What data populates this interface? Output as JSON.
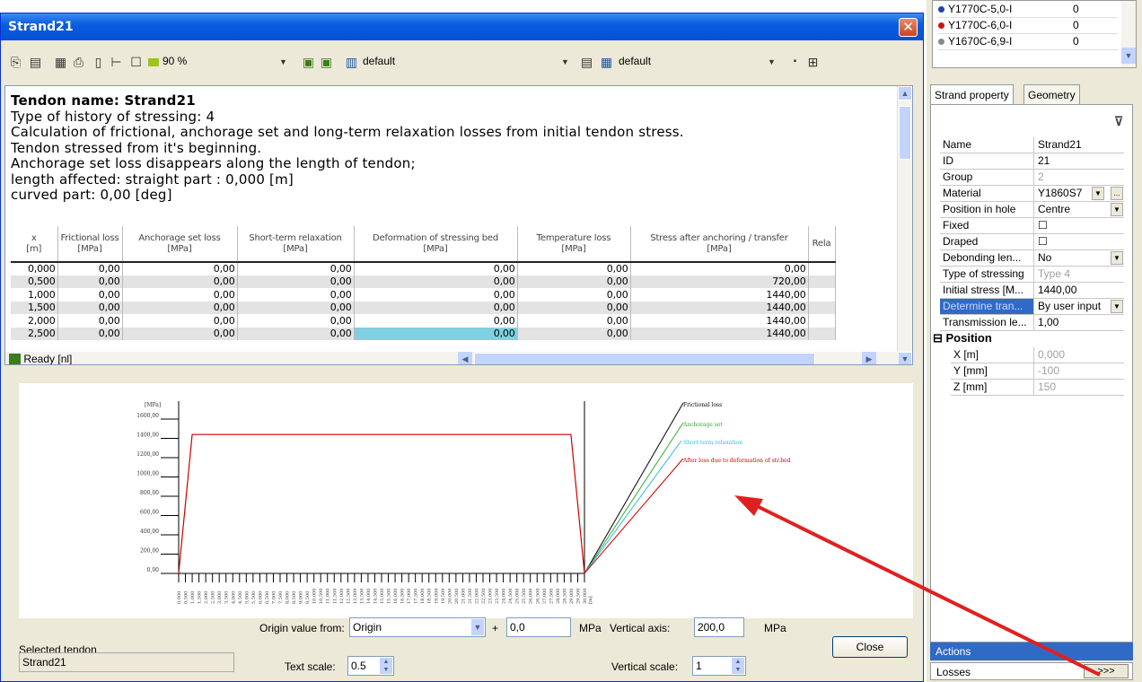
{
  "dialog": {
    "title": "Strand21",
    "close_glyph": "✕"
  },
  "toolbar": {
    "zoom": "90 %",
    "combo1": "default",
    "combo2": "default"
  },
  "report": {
    "heading": "Tendon name:  Strand21",
    "lines": [
      "Type of history of stressing:  4",
      "Calculation of frictional, anchorage set and long-term relaxation losses from initial tendon stress.",
      "Tendon stressed from it's beginning.",
      "Anchorage set loss disappears along the length of tendon;",
      "length affected: straight part : 0,000 [m]",
      "curved part: 0,00 [deg]"
    ],
    "columns": [
      "x\n[m]",
      "Frictional loss\n[MPa]",
      "Anchorage set loss\n[MPa]",
      "Short-term relaxation\n[MPa]",
      "Deformation of stressing bed\n[MPa]",
      "Temperature loss\n[MPa]",
      "Stress after anchoring / transfer\n[MPa]",
      "Rela"
    ],
    "rows": [
      [
        "0,000",
        "0,00",
        "0,00",
        "0,00",
        "0,00",
        "0,00",
        "0,00",
        ""
      ],
      [
        "0,500",
        "0,00",
        "0,00",
        "0,00",
        "0,00",
        "0,00",
        "720,00",
        ""
      ],
      [
        "1,000",
        "0,00",
        "0,00",
        "0,00",
        "0,00",
        "0,00",
        "1440,00",
        ""
      ],
      [
        "1,500",
        "0,00",
        "0,00",
        "0,00",
        "0,00",
        "0,00",
        "1440,00",
        ""
      ],
      [
        "2,000",
        "0,00",
        "0,00",
        "0,00",
        "0,00",
        "0,00",
        "1440,00",
        ""
      ],
      [
        "2,500",
        "0,00",
        "0,00",
        "0,00",
        "0,00",
        "0,00",
        "1440,00",
        ""
      ]
    ],
    "status": "Ready [nl]"
  },
  "chart_data": {
    "type": "line",
    "ylabel": "[MPa]",
    "xunit": "[m]",
    "ylim": [
      0,
      1600
    ],
    "yticks": [
      "1600,00",
      "1400,00",
      "1200,00",
      "1000,00",
      "800,00",
      "600,00",
      "400,00",
      "200,00",
      "0,00"
    ],
    "xlim": [
      0,
      30
    ],
    "xticks": [
      "0,000",
      "0,500",
      "1,000",
      "1,500",
      "2,000",
      "2,500",
      "3,000",
      "3,500",
      "4,000",
      "4,500",
      "5,000",
      "5,500",
      "6,000",
      "6,500",
      "7,000",
      "7,500",
      "8,000",
      "8,500",
      "9,000",
      "9,500",
      "10,000",
      "10,500",
      "11,000",
      "11,500",
      "12,000",
      "12,500",
      "13,000",
      "13,500",
      "14,000",
      "14,500",
      "15,000",
      "15,500",
      "16,000",
      "16,500",
      "17,000",
      "17,500",
      "18,000",
      "18,500",
      "19,000",
      "19,500",
      "20,000",
      "20,500",
      "21,000",
      "21,500",
      "22,000",
      "22,500",
      "23,000",
      "23,500",
      "24,000",
      "24,500",
      "25,000",
      "25,500",
      "26,000",
      "26,500",
      "27,000",
      "27,500",
      "28,000",
      "28,500",
      "29,000",
      "29,500",
      "30,000"
    ],
    "series": [
      {
        "name": "Stress",
        "color": "#cc0000",
        "x": [
          0,
          0.5,
          1,
          29,
          29.5,
          30
        ],
        "y": [
          0,
          720,
          1440,
          1440,
          720,
          0
        ]
      }
    ],
    "legend": [
      {
        "name": "Frictional loss",
        "color": "#000000"
      },
      {
        "name": "Anchorage set",
        "color": "#33aa33"
      },
      {
        "name": "Short-term relaxation",
        "color": "#33bbdd"
      },
      {
        "name": "After loss due to deformation of str.bed",
        "color": "#cc0000"
      }
    ]
  },
  "bottom": {
    "selected_label": "Selected tendon",
    "selected_value": "Strand21",
    "origin_label": "Origin value from:",
    "origin_value": "Origin",
    "plus": "+",
    "offset": "0,0",
    "unit1": "MPa",
    "vaxis_label": "Vertical axis:",
    "vaxis_value": "200,0",
    "unit2": "MPa",
    "textscale_label": "Text scale:",
    "textscale_value": "0.5",
    "vscale_label": "Vertical scale:",
    "vscale_value": "1",
    "close": "Close"
  },
  "material_list": [
    {
      "name": "Y1770C-5,0-I",
      "val": "0",
      "color": "#2244aa"
    },
    {
      "name": "Y1770C-6,0-I",
      "val": "0",
      "color": "#cc1111"
    },
    {
      "name": "Y1670C-6,9-I",
      "val": "0",
      "color": "#888888"
    }
  ],
  "panel": {
    "tab1": "Strand property",
    "tab2": "Geometry",
    "props": [
      {
        "k": "Name",
        "v": "Strand21"
      },
      {
        "k": "ID",
        "v": "21"
      },
      {
        "k": "Group",
        "v": "2"
      },
      {
        "k": "Material",
        "v": "Y1860S7"
      },
      {
        "k": "Position in hole",
        "v": "Centre"
      },
      {
        "k": "Fixed",
        "v": "☐"
      },
      {
        "k": "Draped",
        "v": "☐"
      },
      {
        "k": "Debonding len...",
        "v": "No"
      },
      {
        "k": "Type of stressing",
        "v": "Type 4"
      },
      {
        "k": "Initial stress [M...",
        "v": "1440,00"
      },
      {
        "k": "Determine tran...",
        "v": "By user input"
      },
      {
        "k": "Transmission le...",
        "v": "1,00"
      }
    ],
    "position_header": "Position",
    "position": [
      {
        "k": "X [m]",
        "v": "0,000"
      },
      {
        "k": "Y [mm]",
        "v": "-100"
      },
      {
        "k": "Z [mm]",
        "v": "150"
      }
    ],
    "actions": "Actions",
    "losses": "Losses",
    "losses_btn": ">>>"
  }
}
